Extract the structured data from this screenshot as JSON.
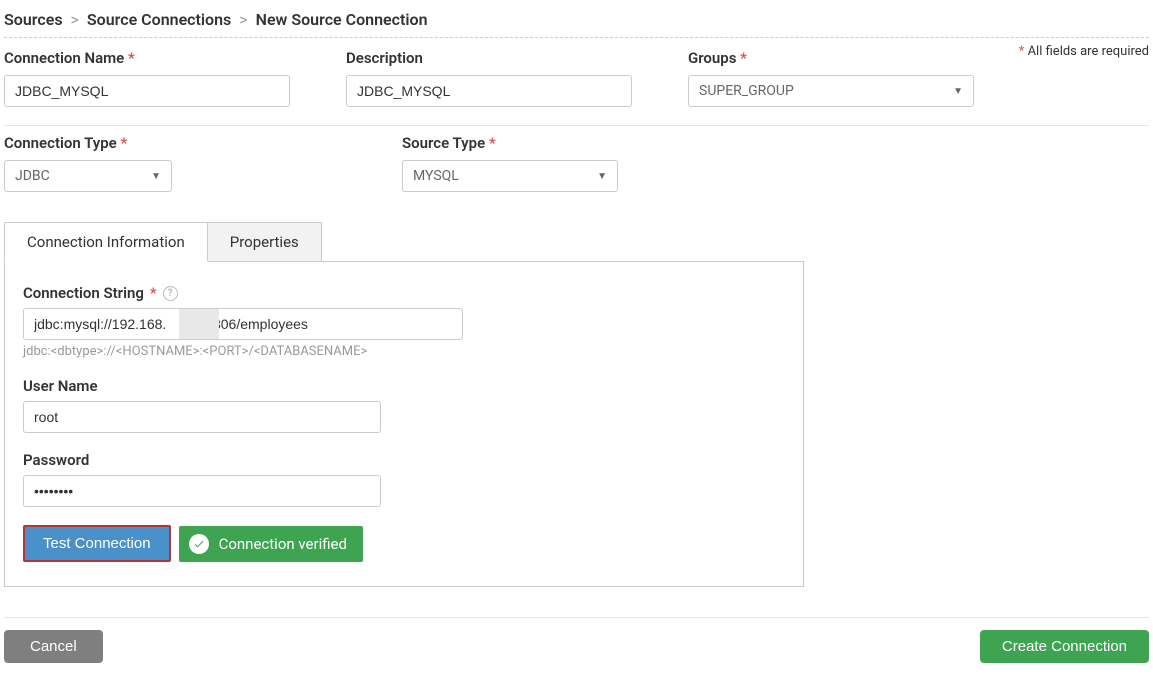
{
  "breadcrumb": {
    "level1": "Sources",
    "level2": "Source Connections",
    "level3": "New Source Connection"
  },
  "required_note": "All fields are required",
  "fields": {
    "connection_name": {
      "label": "Connection Name",
      "value": "JDBC_MYSQL"
    },
    "description": {
      "label": "Description",
      "value": "JDBC_MYSQL"
    },
    "groups": {
      "label": "Groups",
      "value": "SUPER_GROUP"
    },
    "connection_type": {
      "label": "Connection Type",
      "value": "JDBC"
    },
    "source_type": {
      "label": "Source Type",
      "value": "MYSQL"
    }
  },
  "tabs": {
    "connection_info": "Connection Information",
    "properties": "Properties"
  },
  "panel": {
    "connection_string": {
      "label": "Connection String",
      "value": "jdbc:mysql://192.168.         :3306/employees",
      "hint": "jdbc:<dbtype>://<HOSTNAME>:<PORT>/<DATABASENAME>"
    },
    "username": {
      "label": "User Name",
      "value": "root"
    },
    "password": {
      "label": "Password",
      "value": "••••••••"
    },
    "test_button": "Test Connection",
    "status": "Connection verified"
  },
  "footer": {
    "cancel": "Cancel",
    "create": "Create Connection"
  }
}
